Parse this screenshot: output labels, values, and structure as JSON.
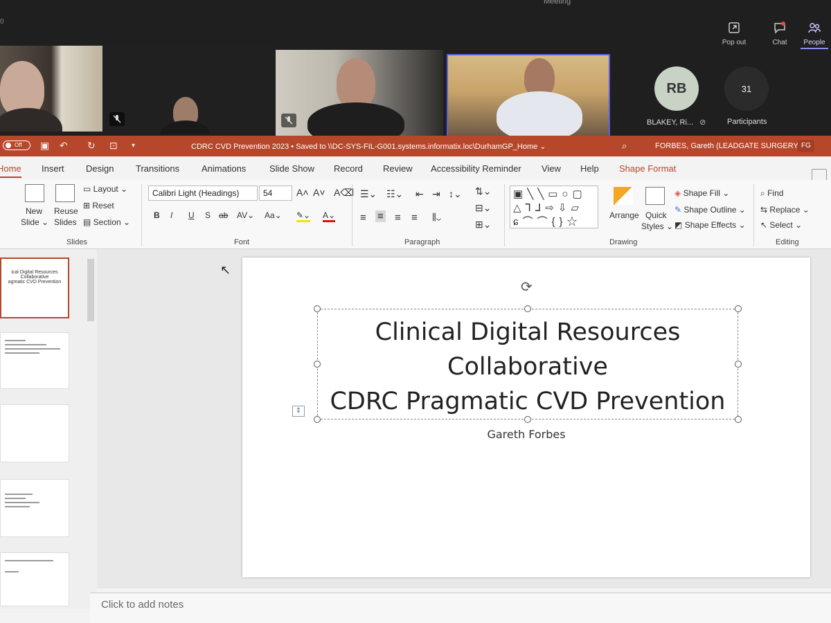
{
  "meeting": {
    "title": "Meeting",
    "timer": "0",
    "buttons": [
      {
        "label": "Pop out",
        "icon": "popout-icon"
      },
      {
        "label": "Chat",
        "icon": "chat-icon"
      },
      {
        "label": "People",
        "icon": "people-icon"
      }
    ],
    "avatar_initials": "RB",
    "avatar_name": "BLAKEY, Ri...",
    "participants_count": "31",
    "participants_label": "Participants"
  },
  "ppt": {
    "autosave_label": "Off",
    "doc_title": "CDRC CVD Prevention 2023 • Saved to \\\\DC-SYS-FIL-G001.systems.informatix.loc\\DurhamGP_Home ⌄",
    "user_name": "FORBES, Gareth (LEADGATE SURGERY)",
    "user_initials": "FG",
    "tabs": [
      "Home",
      "Insert",
      "Design",
      "Transitions",
      "Animations",
      "Slide Show",
      "Record",
      "Review",
      "Accessibility Reminder",
      "View",
      "Help",
      "Shape Format"
    ],
    "ribbon": {
      "slides": {
        "new": "New",
        "new2": "Slide ⌄",
        "reuse": "Reuse",
        "reuse2": "Slides",
        "layout": "Layout ⌄",
        "reset": "Reset",
        "section": "Section ⌄",
        "label": "Slides"
      },
      "font": {
        "name": "Calibri Light (Headings)",
        "size": "54",
        "label": "Font"
      },
      "paragraph": {
        "label": "Paragraph"
      },
      "drawing": {
        "arrange": "Arrange",
        "quick": "Quick",
        "styles": "Styles ⌄",
        "fill": "Shape Fill ⌄",
        "outline": "Shape Outline ⌄",
        "effects": "Shape Effects ⌄",
        "label": "Drawing"
      },
      "editing": {
        "find": "Find",
        "replace": "Replace ⌄",
        "select": "Select ⌄",
        "label": "Editing"
      }
    },
    "slide": {
      "title_line1": "Clinical Digital Resources",
      "title_line2": "Collaborative",
      "title_line3": "CDRC Pragmatic CVD Prevention",
      "subtitle": "Gareth Forbes"
    },
    "thumb1": {
      "line1": "ical Digital Resources",
      "line2": "Collaborative",
      "line3": "agmatic CVD Prevention"
    },
    "notes_placeholder": "Click to add notes"
  }
}
